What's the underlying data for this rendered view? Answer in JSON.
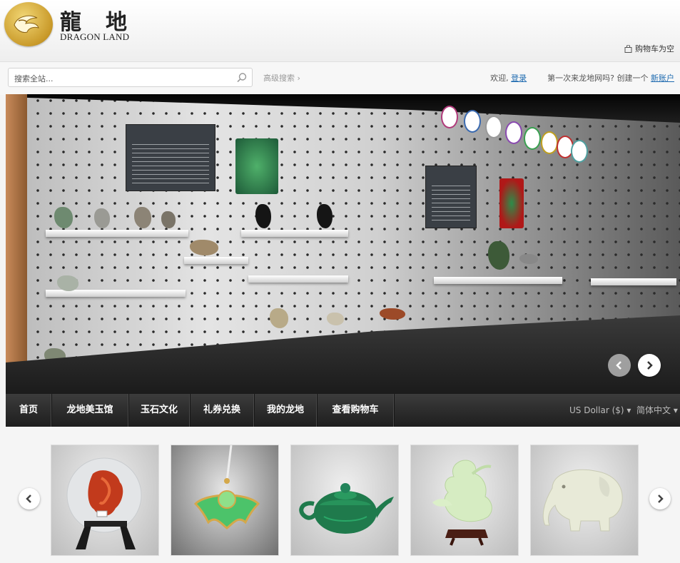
{
  "header": {
    "logo_chars": "龍地",
    "logo_text": "DRAGON LAND",
    "cart_status": "购物车为空"
  },
  "search": {
    "placeholder": "搜索全站...",
    "advanced_label": "高级搜索 ›"
  },
  "account": {
    "welcome": "欢迎,",
    "login_link": "登录",
    "first_visit": "第一次来龙地网吗? 创建一个",
    "register_link": "新账户"
  },
  "nav": {
    "items": [
      {
        "label": "首页"
      },
      {
        "label": "龙地美玉馆"
      },
      {
        "label": "玉石文化"
      },
      {
        "label": "礼券兑换"
      },
      {
        "label": "我的龙地"
      },
      {
        "label": "查看购物车"
      }
    ],
    "currency": "US Dollar ($) ▾",
    "language": "简体中文 ▾"
  },
  "banner": {
    "prev_icon": "chevron-left-icon",
    "next_icon": "chevron-right-icon"
  },
  "carousel": {
    "products": [
      {
        "name": "agate-carving-on-stand"
      },
      {
        "name": "green-jade-pendant"
      },
      {
        "name": "green-jade-teapot"
      },
      {
        "name": "white-jade-phoenix"
      },
      {
        "name": "white-jade-elephant"
      }
    ]
  },
  "colors": {
    "link": "#1f6bb0",
    "nav_bg": "#2a2a2a",
    "logo_gold": "#c99a2a"
  }
}
